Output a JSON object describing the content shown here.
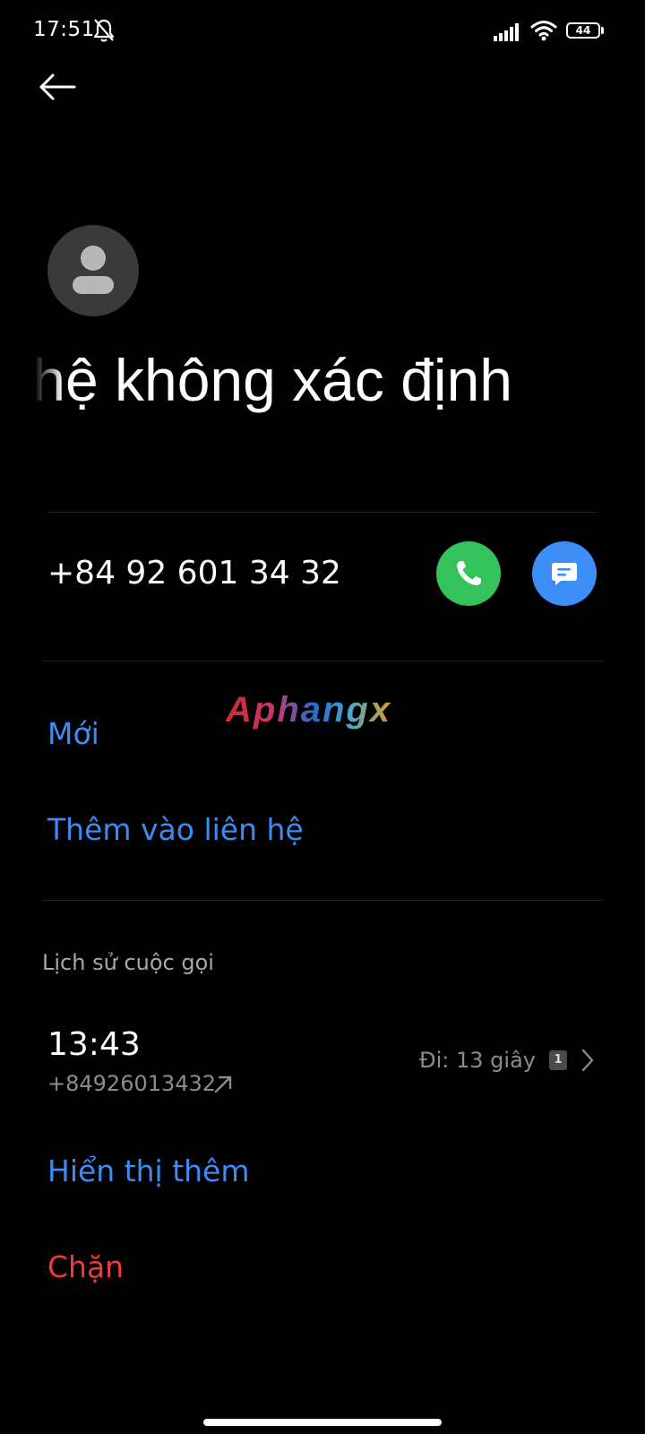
{
  "status_bar": {
    "time": "17:51",
    "battery_level": "44",
    "icons": [
      "bell-off-icon",
      "signal-icon",
      "wifi-icon",
      "battery-icon"
    ]
  },
  "header": {
    "back_icon": "arrow-left-icon"
  },
  "contact": {
    "avatar_icon": "person-icon",
    "name": "Liên hệ không xác định",
    "phone_number": "+84 92 601 34 32",
    "call_icon": "phone-icon",
    "message_icon": "message-icon"
  },
  "colors": {
    "background": "#000000",
    "accent_link": "#3b8cf5",
    "call_button": "#34c25a",
    "message_button": "#3d8ef7",
    "danger": "#ef3a3a"
  },
  "actions": {
    "new": "Mới",
    "add_to_contact": "Thêm vào liên hệ"
  },
  "watermark": "Aphangx",
  "call_history": {
    "title": "Lịch sử cuộc gọi",
    "entries": [
      {
        "time": "13:43",
        "number": "+84926013432",
        "direction_icon": "outgoing-arrow-icon",
        "duration": "Đi: 13 giây",
        "sim": "1"
      }
    ],
    "show_more": "Hiển thị thêm"
  },
  "block": "Chặn"
}
